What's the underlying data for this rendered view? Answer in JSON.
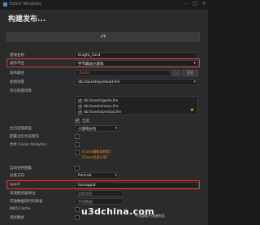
{
  "window": {
    "title": "Editor Windows"
  },
  "heading": "构建发布...",
  "tab": "cfb",
  "fields": [
    {
      "label": "游戏名称",
      "value": "Knight_Card"
    },
    {
      "label": "发布平台",
      "value": "字节跳动小游戏"
    },
    {
      "label": "发布路径",
      "value": "./build",
      "buttons": [
        "...",
        "打开"
      ]
    },
    {
      "label": "初始场景",
      "value": "db://assets/preload.fire"
    },
    {
      "label": "参与构建场景"
    }
  ],
  "scenes": [
    "db://assets/game.fire",
    "db://assets/menu.fire",
    "db://assets/preload.fire"
  ],
  "select_all_label": "全选",
  "options": [
    {
      "label": "主包压缩类型",
      "value": "小游戏分包"
    },
    {
      "label": "配置主包为远程包"
    },
    {
      "label": "合并 Cocos Analytics"
    },
    {
      "label": "",
      "links": [
        "[Cocos编辑器教程]",
        "[Cocos资源分享]"
      ]
    },
    {
      "label": "自动合并图集"
    },
    {
      "label": "设备方向",
      "value": "Portrait"
    },
    {
      "label": "appid",
      "value": "tomappid"
    },
    {
      "label": "资源服务器地址",
      "placeholder": "远程地址"
    },
    {
      "label": "开放数据域代码目录",
      "placeholder": "开放数据"
    },
    {
      "label": "MD5 Cache"
    },
    {
      "label": "调试模式"
    }
  ],
  "watermark": {
    "logo": "u3dchina.com",
    "sub": "中文游戏·开发者社区"
  },
  "colors": {
    "highlight": "#d24242",
    "star": "#f0c030",
    "link": "#e08a33"
  }
}
